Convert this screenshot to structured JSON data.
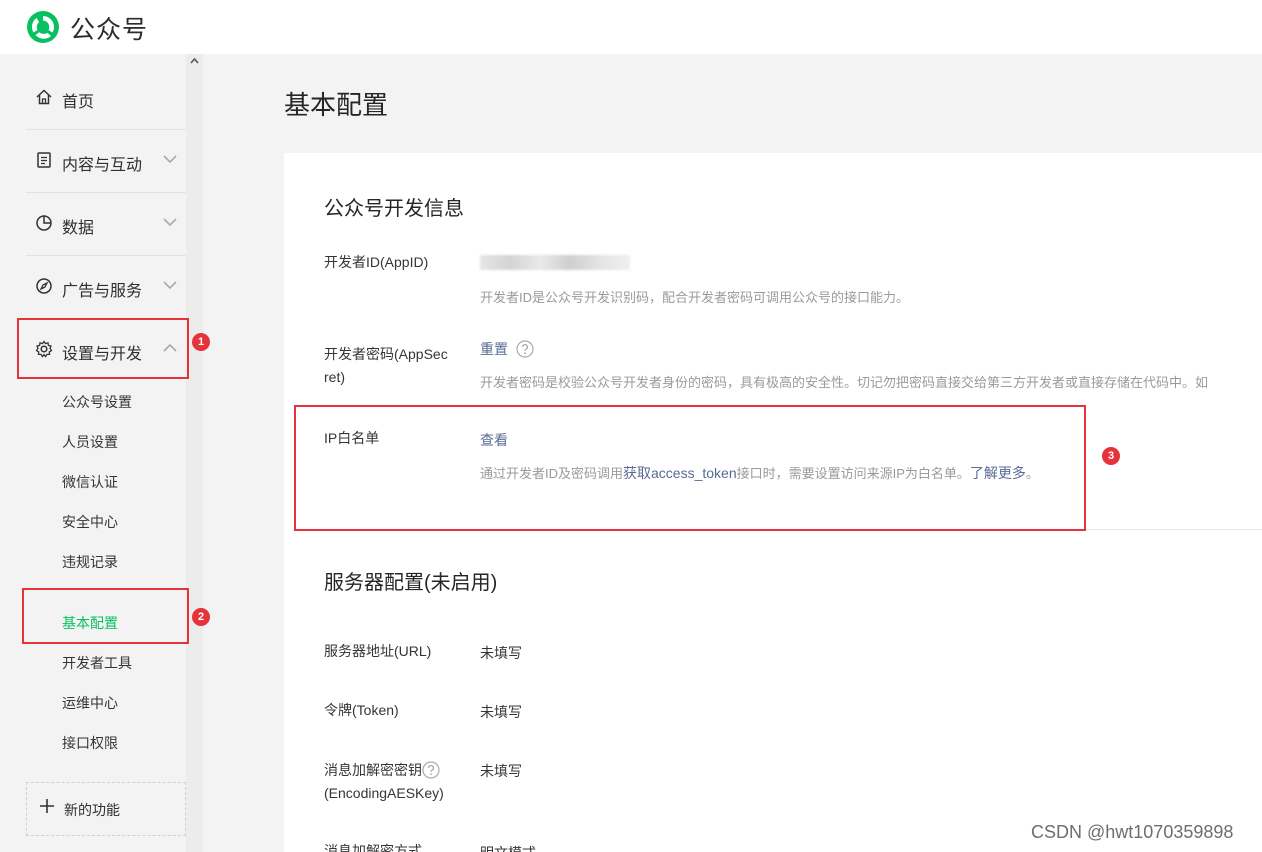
{
  "app": {
    "title": "公众号"
  },
  "sidebar": {
    "items": [
      {
        "label": "首页",
        "icon": "home-icon"
      },
      {
        "label": "内容与互动",
        "icon": "document-icon"
      },
      {
        "label": "数据",
        "icon": "pie-chart-icon"
      },
      {
        "label": "广告与服务",
        "icon": "compass-icon"
      },
      {
        "label": "设置与开发",
        "icon": "gear-icon"
      }
    ],
    "subitems": [
      "公众号设置",
      "人员设置",
      "微信认证",
      "安全中心",
      "违规记录",
      "基本配置",
      "开发者工具",
      "运维中心",
      "接口权限"
    ],
    "active_subitem": "基本配置",
    "new_feature": "新的功能"
  },
  "main": {
    "title": "基本配置",
    "dev_info": {
      "title": "公众号开发信息",
      "appid_label": "开发者ID(AppID)",
      "appid_desc": "开发者ID是公众号开发识别码，配合开发者密码可调用公众号的接口能力。",
      "secret_label_1": "开发者密码(AppSec",
      "secret_label_2": "ret)",
      "secret_action": "重置",
      "secret_desc": "开发者密码是校验公众号开发者身份的密码，具有极高的安全性。切记勿把密码直接交给第三方开发者或直接存储在代码中。如",
      "ip_label": "IP白名单",
      "ip_action": "查看",
      "ip_desc_pre": "通过开发者ID及密码调用",
      "ip_desc_link": "获取access_token",
      "ip_desc_mid": "接口时，需要设置访问来源IP为白名单。",
      "ip_desc_more": "了解更多",
      "ip_desc_end": "。"
    },
    "server_config": {
      "title": "服务器配置(未启用)",
      "url_label": "服务器地址(URL)",
      "url_value": "未填写",
      "token_label": "令牌(Token)",
      "token_value": "未填写",
      "aes_label_1": "消息加解密密钥",
      "aes_label_2": "(EncodingAESKey)",
      "aes_value": "未填写",
      "mode_label": "消息加解密方式",
      "mode_value": "明文模式"
    }
  },
  "annotations": [
    "1",
    "2",
    "3"
  ],
  "watermark": "CSDN @hwt1070359898",
  "colors": {
    "accent_green": "#07c160",
    "link": "#576b95",
    "annotation_red": "#e5333a"
  }
}
